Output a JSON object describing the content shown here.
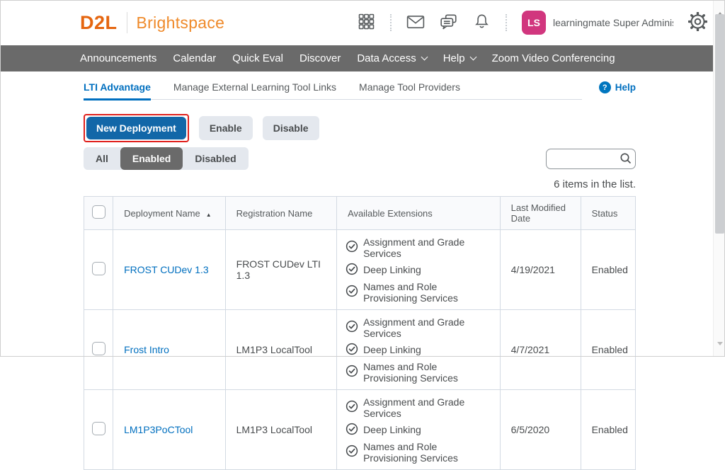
{
  "header": {
    "logo_primary": "D2L",
    "logo_secondary": "Brightspace",
    "user_initials": "LS",
    "user_name": "learningmate Super Administra..."
  },
  "navbar": {
    "items": [
      {
        "label": "Announcements",
        "has_dropdown": false
      },
      {
        "label": "Calendar",
        "has_dropdown": false
      },
      {
        "label": "Quick Eval",
        "has_dropdown": false
      },
      {
        "label": "Discover",
        "has_dropdown": false
      },
      {
        "label": "Data Access",
        "has_dropdown": true
      },
      {
        "label": "Help",
        "has_dropdown": true
      },
      {
        "label": "Zoom Video Conferencing",
        "has_dropdown": false
      }
    ]
  },
  "tabs": [
    {
      "label": "LTI Advantage",
      "active": true
    },
    {
      "label": "Manage External Learning Tool Links",
      "active": false
    },
    {
      "label": "Manage Tool Providers",
      "active": false
    }
  ],
  "help_link": {
    "label": "Help",
    "icon_glyph": "?"
  },
  "toolbar": {
    "new_deployment_label": "New Deployment",
    "enable_label": "Enable",
    "disable_label": "Disable"
  },
  "filters": {
    "all_label": "All",
    "enabled_label": "Enabled",
    "disabled_label": "Disabled",
    "selected": "Enabled"
  },
  "search": {
    "value": "",
    "placeholder": ""
  },
  "list_summary": "6 items in the list.",
  "table": {
    "columns": {
      "deployment_name": "Deployment Name",
      "registration_name": "Registration Name",
      "available_extensions": "Available Extensions",
      "last_modified_date": "Last Modified Date",
      "status": "Status"
    },
    "sort": {
      "column": "Deployment Name",
      "direction": "ascending",
      "glyph": "▲"
    },
    "rows": [
      {
        "deployment_name": "FROST CUDev 1.3",
        "registration_name": "FROST CUDev LTI 1.3",
        "extensions": [
          "Assignment and Grade Services",
          "Deep Linking",
          "Names and Role Provisioning Services"
        ],
        "last_modified_date": "4/19/2021",
        "status": "Enabled"
      },
      {
        "deployment_name": "Frost Intro",
        "registration_name": "LM1P3 LocalTool",
        "extensions": [
          "Assignment and Grade Services",
          "Deep Linking",
          "Names and Role Provisioning Services"
        ],
        "last_modified_date": "4/7/2021",
        "status": "Enabled"
      },
      {
        "deployment_name": "LM1P3PoCTool",
        "registration_name": "LM1P3 LocalTool",
        "extensions": [
          "Assignment and Grade Services",
          "Deep Linking",
          "Names and Role Provisioning Services"
        ],
        "last_modified_date": "6/5/2020",
        "status": "Enabled"
      }
    ]
  },
  "colors": {
    "brand_orange": "#e5650f",
    "brand_orange_light": "#ef8a2a",
    "navbar_bg": "#6a6a6a",
    "accent_blue": "#006fbf",
    "primary_button_bg": "#1267a8",
    "annotation_red": "#e0201c",
    "avatar_pink": "#d1367e",
    "segment_selected_bg": "#6a6a6a",
    "table_border": "#d3dae3",
    "table_header_bg": "#f9fafc",
    "text_dark": "#494c4e"
  }
}
